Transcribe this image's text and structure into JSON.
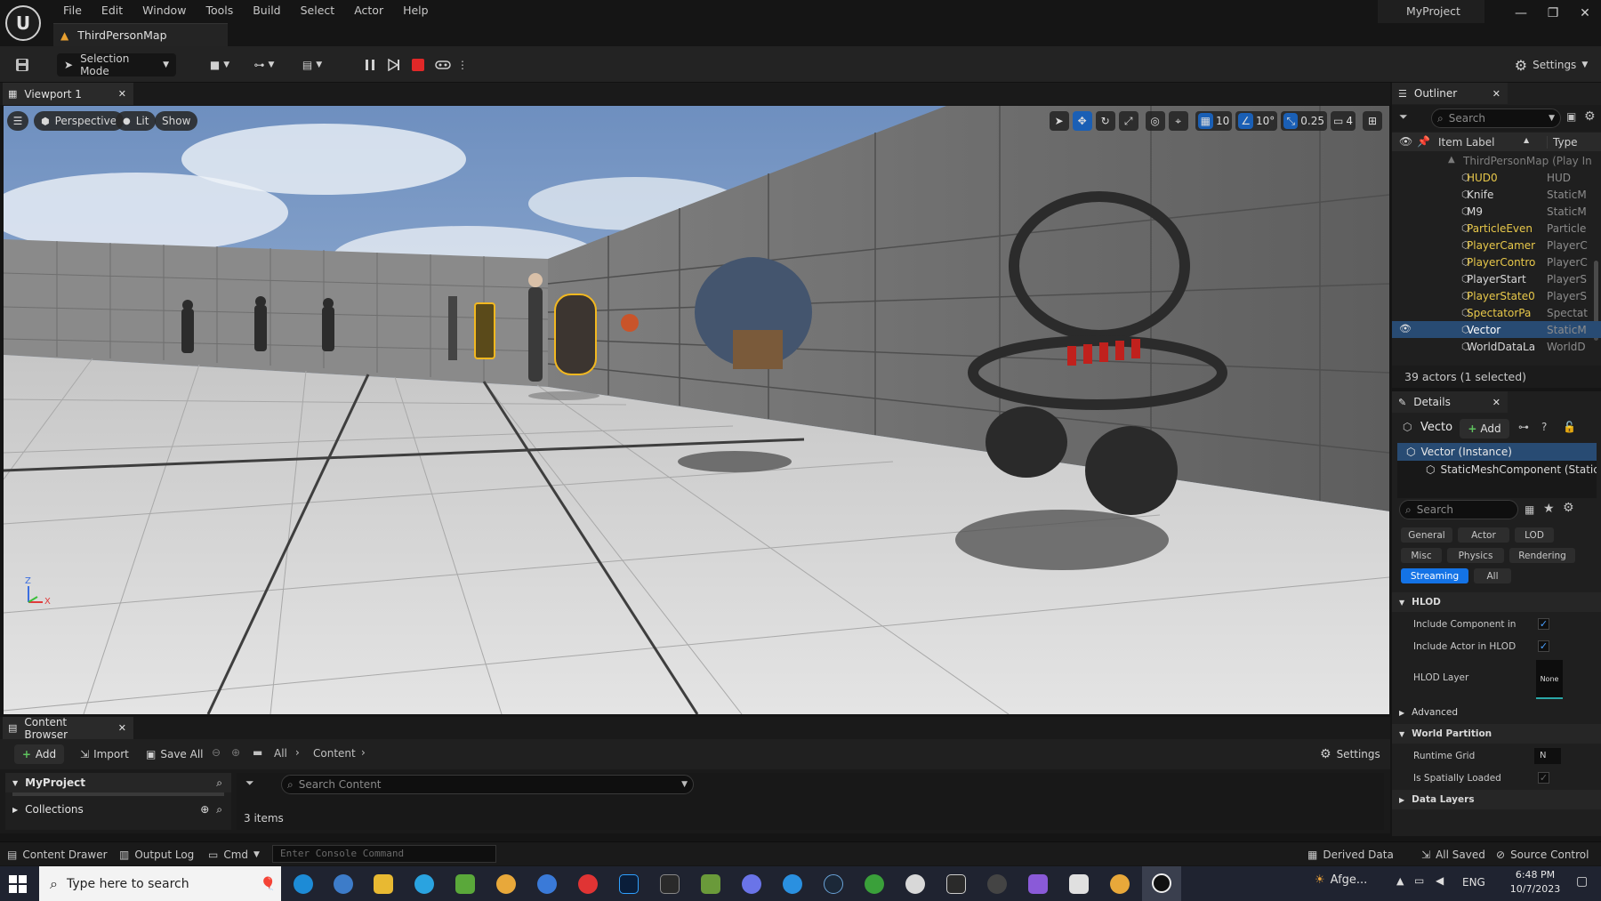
{
  "app": {
    "project_name": "MyProject",
    "map_tab": "ThirdPersonMap",
    "menu": [
      "File",
      "Edit",
      "Window",
      "Tools",
      "Build",
      "Select",
      "Actor",
      "Help"
    ]
  },
  "toolbar": {
    "selection_mode": "Selection Mode",
    "settings_label": "Settings"
  },
  "viewport": {
    "tab_label": "Viewport 1",
    "perspective_label": "Perspective",
    "lit_label": "Lit",
    "show_label": "Show",
    "grid_snap": "10",
    "rotation_snap": "10°",
    "scale_snap": "0.25",
    "camera_speed": "4",
    "axis_z": "Z",
    "axis_x": "X"
  },
  "outliner": {
    "tab_label": "Outliner",
    "search_placeholder": "Search",
    "col_label": "Item Label",
    "col_type": "Type",
    "root_label": "ThirdPersonMap (Play In",
    "items": [
      {
        "label": "HUD0",
        "type": "HUD",
        "color": "#e8c84a"
      },
      {
        "label": "Knife",
        "type": "StaticM",
        "color": "#d8d8d8"
      },
      {
        "label": "M9",
        "type": "StaticM",
        "color": "#d8d8d8"
      },
      {
        "label": "ParticleEven",
        "type": "Particle",
        "color": "#e8c84a"
      },
      {
        "label": "PlayerCamer",
        "type": "PlayerC",
        "color": "#e8c84a"
      },
      {
        "label": "PlayerContro",
        "type": "PlayerC",
        "color": "#e8c84a"
      },
      {
        "label": "PlayerStart",
        "type": "PlayerS",
        "color": "#d8d8d8"
      },
      {
        "label": "PlayerState0",
        "type": "PlayerS",
        "color": "#e8c84a"
      },
      {
        "label": "SpectatorPa",
        "type": "Spectat",
        "color": "#e8c84a"
      },
      {
        "label": "Vector",
        "type": "StaticM",
        "color": "#ffffff"
      },
      {
        "label": "WorldDataLa",
        "type": "WorldD",
        "color": "#d8d8d8"
      }
    ],
    "footer": "39 actors (1 selected)"
  },
  "details": {
    "tab_label": "Details",
    "actor_name": "Vecto",
    "add_label": "Add",
    "instance_label": "Vector (Instance)",
    "component_label": "StaticMeshComponent (StaticM",
    "search_placeholder": "Search",
    "categories": [
      "General",
      "Actor",
      "LOD",
      "Misc",
      "Physics",
      "Rendering",
      "Streaming",
      "All"
    ],
    "active_category": "Streaming",
    "hlod_header": "HLOD",
    "include_component": "Include Component in H...",
    "include_actor": "Include Actor in HLOD",
    "hlod_layer": "HLOD Layer",
    "hlod_layer_value": "None",
    "advanced": "Advanced",
    "world_partition": "World Partition",
    "runtime_grid": "Runtime Grid",
    "runtime_grid_value": "N",
    "spatially_loaded": "Is Spatially Loaded",
    "data_layers": "Data Layers"
  },
  "content_browser": {
    "tab_label": "Content Browser",
    "add_label": "Add",
    "import_label": "Import",
    "save_all_label": "Save All",
    "crumb_all": "All",
    "crumb_content": "Content",
    "settings_label": "Settings",
    "project_root": "MyProject",
    "collections": "Collections",
    "search_placeholder": "Search Content",
    "item_count": "3 items"
  },
  "statusbar": {
    "content_drawer": "Content Drawer",
    "output_log": "Output Log",
    "cmd": "Cmd",
    "console_placeholder": "Enter Console Command",
    "derived_data": "Derived Data",
    "all_saved": "All Saved",
    "source_control": "Source Control"
  },
  "taskbar": {
    "search_placeholder": "Type here to search",
    "weather": "Afge...",
    "language": "ENG",
    "time": "6:48 PM",
    "date": "10/7/2023"
  }
}
